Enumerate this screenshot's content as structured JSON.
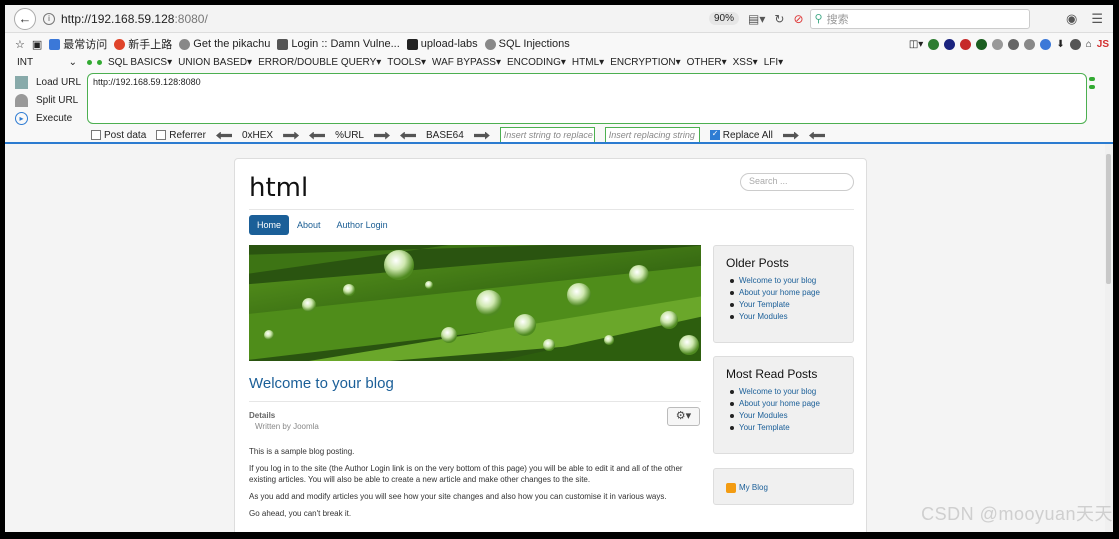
{
  "browser": {
    "url_host": "http://192.168.59.128",
    "url_port": ":8080/",
    "zoom": "90%",
    "search_placeholder": "搜索"
  },
  "bookmarks": [
    {
      "label": "最常访问",
      "color": "#3b78d8"
    },
    {
      "label": "新手上路",
      "color": "#e0442a"
    },
    {
      "label": "Get the pikachu",
      "color": "#888888"
    },
    {
      "label": "Login :: Damn Vulne...",
      "color": "#555555"
    },
    {
      "label": "upload-labs",
      "color": "#222222"
    },
    {
      "label": "SQL Injections",
      "color": "#888888"
    }
  ],
  "hackbar": {
    "select": "INT",
    "menus": [
      "SQL BASICS",
      "UNION BASED",
      "ERROR/DOUBLE QUERY",
      "TOOLS",
      "WAF BYPASS",
      "ENCODING",
      "HTML",
      "ENCRYPTION",
      "OTHER",
      "XSS",
      "LFI"
    ],
    "actions": [
      "Load URL",
      "Split URL",
      "Execute"
    ],
    "textarea": "http://192.168.59.128:8080",
    "post_data": "Post data",
    "referrer": "Referrer",
    "hex": "0xHEX",
    "url": "%URL",
    "base64": "BASE64",
    "insert_placeholder": "Insert string to replace",
    "replacing_placeholder": "Insert replacing string",
    "replace_all": "Replace All"
  },
  "site": {
    "title": "html",
    "search_placeholder": "Search ...",
    "nav": [
      "Home",
      "About",
      "Author Login"
    ],
    "article_title": "Welcome to your blog",
    "details_label": "Details",
    "written_by": "Written by Joomla",
    "paragraphs": [
      "This is a sample blog posting.",
      "If you log in to the site (the Author Login link is on the very bottom of this page) you will be able to edit it and all of the other existing articles. You will also be able to create a new article and make other changes to the site.",
      "As you add and modify articles you will see how your site changes and also how you can customise it in various ways.",
      "Go ahead, you can't break it."
    ],
    "older_posts": {
      "title": "Older Posts",
      "items": [
        "Welcome to your blog",
        "About your home page",
        "Your Template",
        "Your Modules"
      ]
    },
    "most_read": {
      "title": "Most Read Posts",
      "items": [
        "Welcome to your blog",
        "About your home page",
        "Your Modules",
        "Your Template"
      ]
    },
    "feed": "My Blog"
  },
  "watermark": "CSDN @mooyuan天天"
}
